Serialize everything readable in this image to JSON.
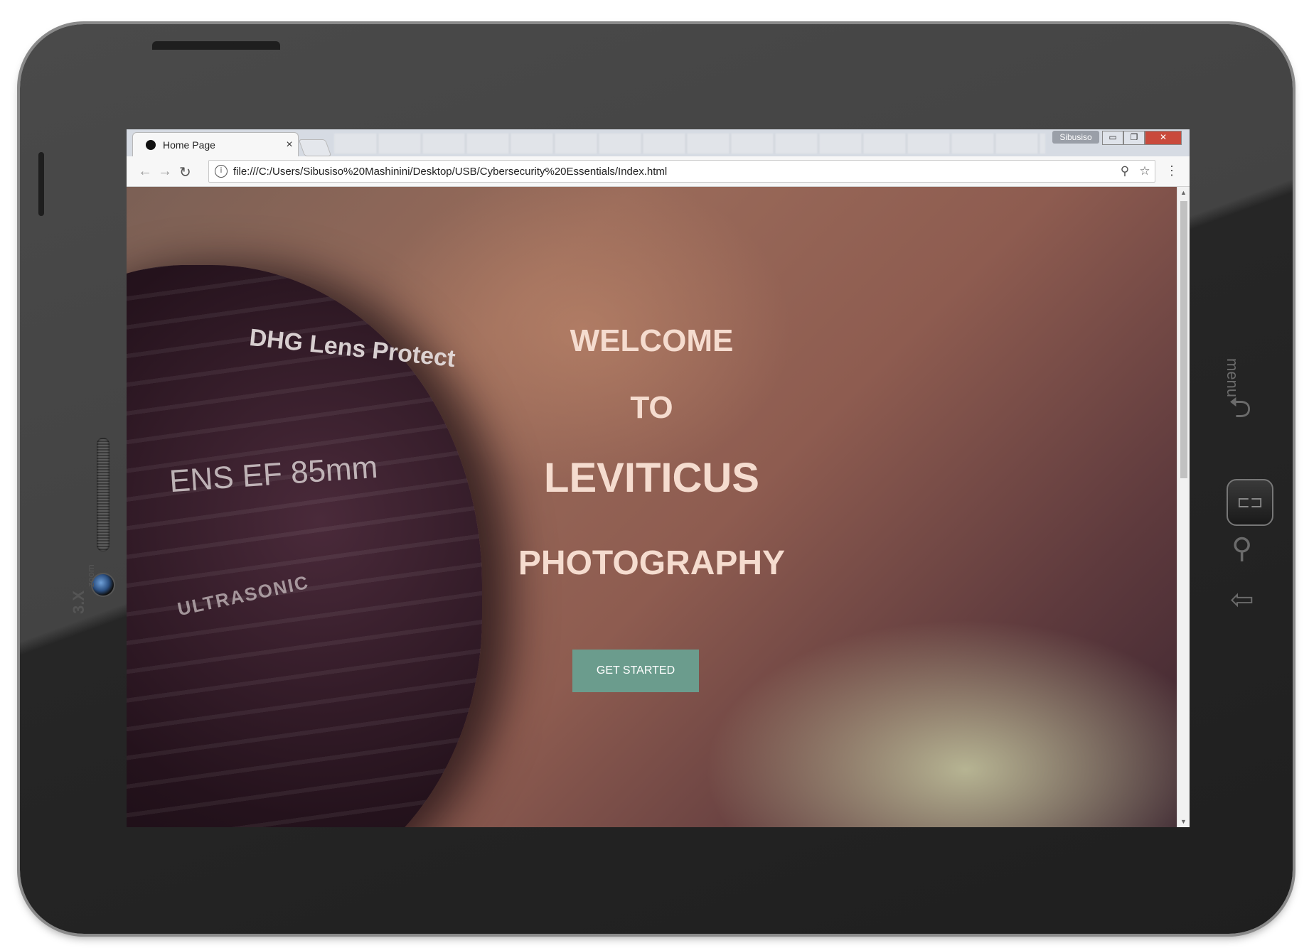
{
  "device": {
    "zoom_label": "3.X",
    "zoom_sub": "zoom",
    "menu_label": "menu"
  },
  "browser": {
    "tab_title": "Home Page",
    "tab_close": "×",
    "window_user": "Sibusiso",
    "url": "file:///C:/Users/Sibusiso%20Mashinini/Desktop/USB/Cybersecurity%20Essentials/Index.html"
  },
  "page": {
    "lens_brand": "DHG  Lens Protect",
    "lens_spec": "ENS   EF   85mm",
    "lens_ring": "ULTRASONIC",
    "hero_lines": [
      "WELCOME",
      "TO",
      "LEVITICUS",
      "PHOTOGRAPHY"
    ],
    "cta_label": "GET STARTED"
  },
  "colors": {
    "hero_text": "#f5dccf",
    "cta_bg": "#6b9c8d"
  }
}
